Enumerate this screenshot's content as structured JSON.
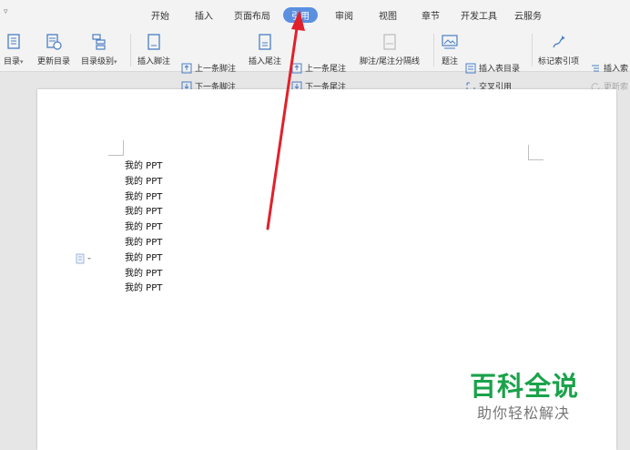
{
  "tabs": [
    "开始",
    "插入",
    "页面布局",
    "引用",
    "审阅",
    "视图",
    "章节",
    "开发工具",
    "云服务"
  ],
  "active_tab": "引用",
  "quick_access_glyph": "▿",
  "ribbon": {
    "toc": "目录",
    "update_toc": "更新目录",
    "toc_level": "目录级别",
    "insert_footnote": "插入脚注",
    "prev_footnote": "上一条脚注",
    "next_footnote": "下一条脚注",
    "insert_endnote": "插入尾注",
    "prev_endnote": "上一条尾注",
    "next_endnote": "下一条尾注",
    "footnote_separator": "脚注/尾注分隔线",
    "caption": "题注",
    "insert_table_of_figures": "插入表目录",
    "cross_reference": "交叉引用",
    "mark_index_entry": "标记索引项",
    "insert_index": "插入索",
    "update_index": "更新索"
  },
  "document": {
    "lines": [
      "我的 PPT",
      "我的 PPT",
      "我的 PPT",
      "我的 PPT",
      "我的 PPT",
      "我的 PPT",
      "我的 PPT",
      "我的 PPT",
      "我的 PPT"
    ]
  },
  "watermark": {
    "title": "百科全说",
    "subtitle": "助你轻松解决"
  },
  "colors": {
    "active_tab": "#5b8fe0",
    "arrow": "#e0212b",
    "watermark_green": "#1aa24a"
  }
}
